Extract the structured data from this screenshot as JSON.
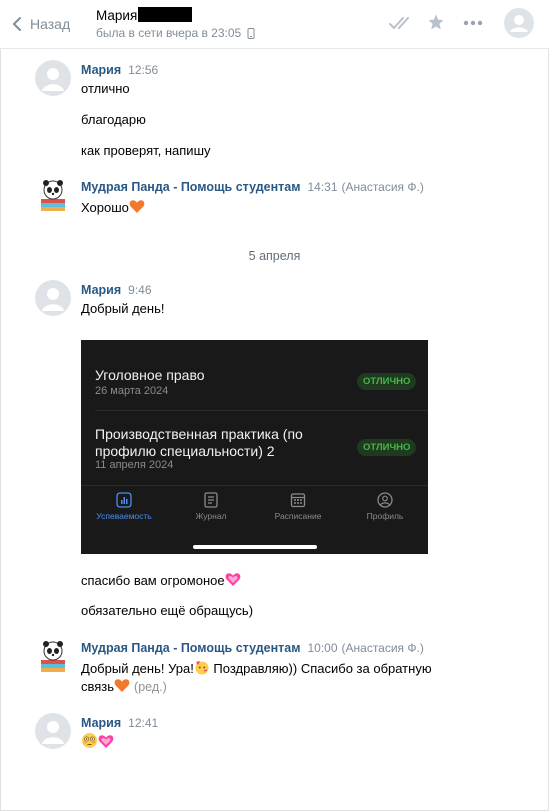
{
  "header": {
    "back_label": "Назад",
    "peer_name": "Мария",
    "peer_status": "была в сети вчера в 23:05"
  },
  "messages": [
    {
      "author": "Мария",
      "time": "12:56",
      "lines": [
        "отлично",
        "благодарю",
        "как проверят, напишу"
      ]
    },
    {
      "author": "Мудрая Панда - Помощь студентам",
      "time": "14:31",
      "note": "(Анастасия Ф.)",
      "text": "Хорошо"
    },
    {
      "author": "Мария",
      "time": "9:46",
      "text": "Добрый день!",
      "after": [
        "спасибо вам огромоное",
        "обязательно ещё обращусь)"
      ]
    },
    {
      "author": "Мудрая Панда - Помощь студентам",
      "time": "10:00",
      "note": "(Анастасия Ф.)",
      "line1_a": "Добрый день! Ура!",
      "line1_b": " Поздравляю)) Спасибо за обратную",
      "line2": "связь",
      "edited": "(ред.)"
    },
    {
      "author": "Мария",
      "time": "12:41"
    }
  ],
  "date_separator": "5 апреля",
  "attachment": {
    "grades": [
      {
        "subject": "Уголовное право",
        "date": "26 марта 2024",
        "grade": "ОТЛИЧНО"
      },
      {
        "subject_line1": "Производственная практика (по",
        "subject_line2": "профилю специальности) 2",
        "date": "11 апреля 2024",
        "grade": "ОТЛИЧНО"
      }
    ],
    "tabs": [
      "Успеваемость",
      "Журнал",
      "Расписание",
      "Профиль"
    ],
    "active_tab": "Успеваемость"
  },
  "colors": {
    "link": "#2a5885",
    "muted": "#818c99",
    "accent_blue": "#4a8ef0",
    "grade_green": "#4bb34b"
  }
}
